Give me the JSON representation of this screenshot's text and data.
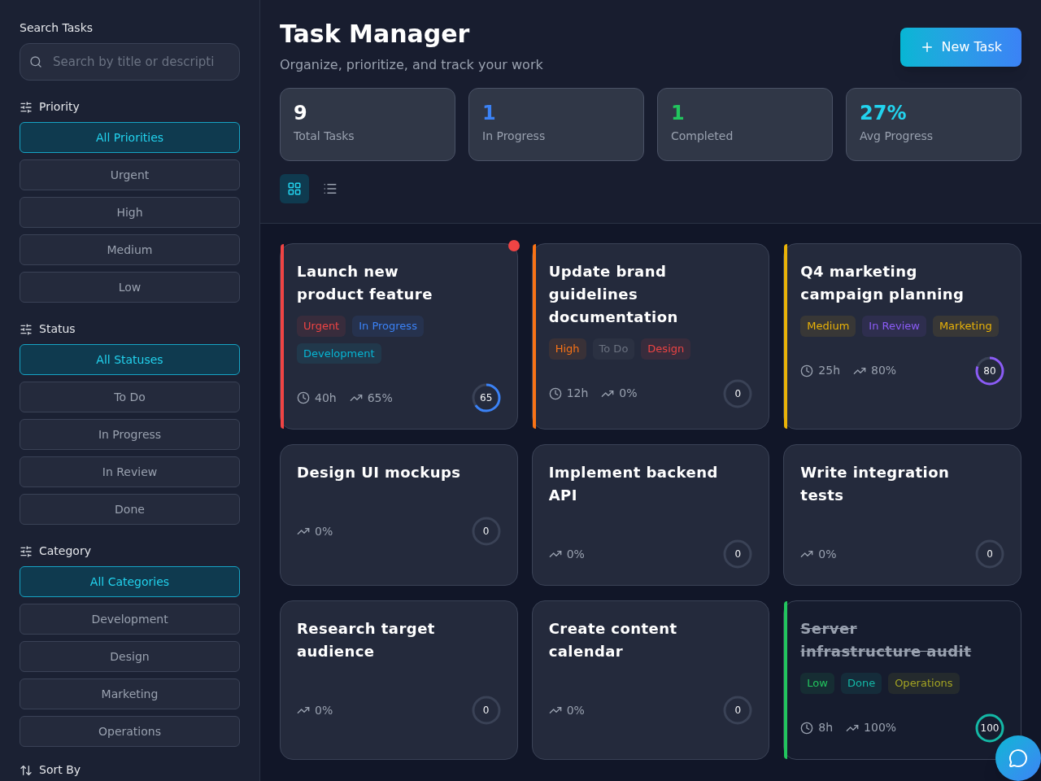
{
  "sidebar": {
    "search": {
      "label": "Search Tasks",
      "placeholder": "Search by title or descripti"
    },
    "filters": [
      {
        "title": "Priority",
        "options": [
          {
            "label": "All Priorities",
            "selected": true
          },
          {
            "label": "Urgent",
            "selected": false
          },
          {
            "label": "High",
            "selected": false
          },
          {
            "label": "Medium",
            "selected": false
          },
          {
            "label": "Low",
            "selected": false
          }
        ]
      },
      {
        "title": "Status",
        "options": [
          {
            "label": "All Statuses",
            "selected": true
          },
          {
            "label": "To Do",
            "selected": false
          },
          {
            "label": "In Progress",
            "selected": false
          },
          {
            "label": "In Review",
            "selected": false
          },
          {
            "label": "Done",
            "selected": false
          }
        ]
      },
      {
        "title": "Category",
        "options": [
          {
            "label": "All Categories",
            "selected": true
          },
          {
            "label": "Development",
            "selected": false
          },
          {
            "label": "Design",
            "selected": false
          },
          {
            "label": "Marketing",
            "selected": false
          },
          {
            "label": "Operations",
            "selected": false
          }
        ]
      }
    ],
    "sort_label": "Sort By"
  },
  "header": {
    "title": "Task Manager",
    "subtitle": "Organize, prioritize, and track your work",
    "new_button": "New Task"
  },
  "stats": [
    {
      "value": "9",
      "label": "Total Tasks",
      "color": "#ffffff"
    },
    {
      "value": "1",
      "label": "In Progress",
      "color": "#3b82f6"
    },
    {
      "value": "1",
      "label": "Completed",
      "color": "#22c55e"
    },
    {
      "value": "27%",
      "label": "Avg Progress",
      "color": "#22d3ee"
    }
  ],
  "view_toggle": [
    {
      "kind": "grid",
      "selected": true
    },
    {
      "kind": "list",
      "selected": false
    }
  ],
  "tasks": [
    {
      "title": "Launch new product feature",
      "alert": true,
      "done": false,
      "tags": [
        {
          "label": "Urgent",
          "color": "#ef4444"
        },
        {
          "label": "In Progress",
          "color": "#3b82f6"
        },
        {
          "label": "Development",
          "color": "#06b6d4"
        }
      ],
      "hours": "40h",
      "progress": "65%",
      "ring": "65",
      "level": 0.65
    },
    {
      "title": "Update brand guidelines documentation",
      "alert": false,
      "done": false,
      "tags": [
        {
          "label": "High",
          "color": "#f97316"
        },
        {
          "label": "To Do",
          "color": "#6b7280"
        },
        {
          "label": "Design",
          "color": "#ef4444"
        }
      ],
      "hours": "12h",
      "progress": "0%",
      "ring": "0",
      "level": 0
    },
    {
      "title": "Q4 marketing campaign planning",
      "alert": false,
      "done": false,
      "tags": [
        {
          "label": "Medium",
          "color": "#eab308"
        },
        {
          "label": "In Review",
          "color": "#8b5cf6"
        },
        {
          "label": "Marketing",
          "color": "#eab308"
        }
      ],
      "hours": "25h",
      "progress": "80%",
      "ring": "80",
      "level": 0.8
    },
    {
      "title": "Design UI mockups",
      "alert": false,
      "done": false,
      "progress": "0%",
      "ring": "0",
      "level": 0
    },
    {
      "title": "Implement backend API",
      "alert": false,
      "done": false,
      "progress": "0%",
      "ring": "0",
      "level": 0
    },
    {
      "title": "Write integration tests",
      "alert": false,
      "done": false,
      "progress": "0%",
      "ring": "0",
      "level": 0
    },
    {
      "title": "Research target audience",
      "alert": false,
      "done": false,
      "progress": "0%",
      "ring": "0",
      "level": 0
    },
    {
      "title": "Create content calendar",
      "alert": false,
      "done": false,
      "progress": "0%",
      "ring": "0",
      "level": 0
    },
    {
      "title": "Server infrastructure audit",
      "alert": false,
      "done": true,
      "tags": [
        {
          "label": "Low",
          "color": "#22c55e"
        },
        {
          "label": "Done",
          "color": "#14b8a6"
        },
        {
          "label": "Operations",
          "color": "#a3a323"
        }
      ],
      "hours": "8h",
      "progress": "100%",
      "ring": "100",
      "level": 1
    }
  ]
}
